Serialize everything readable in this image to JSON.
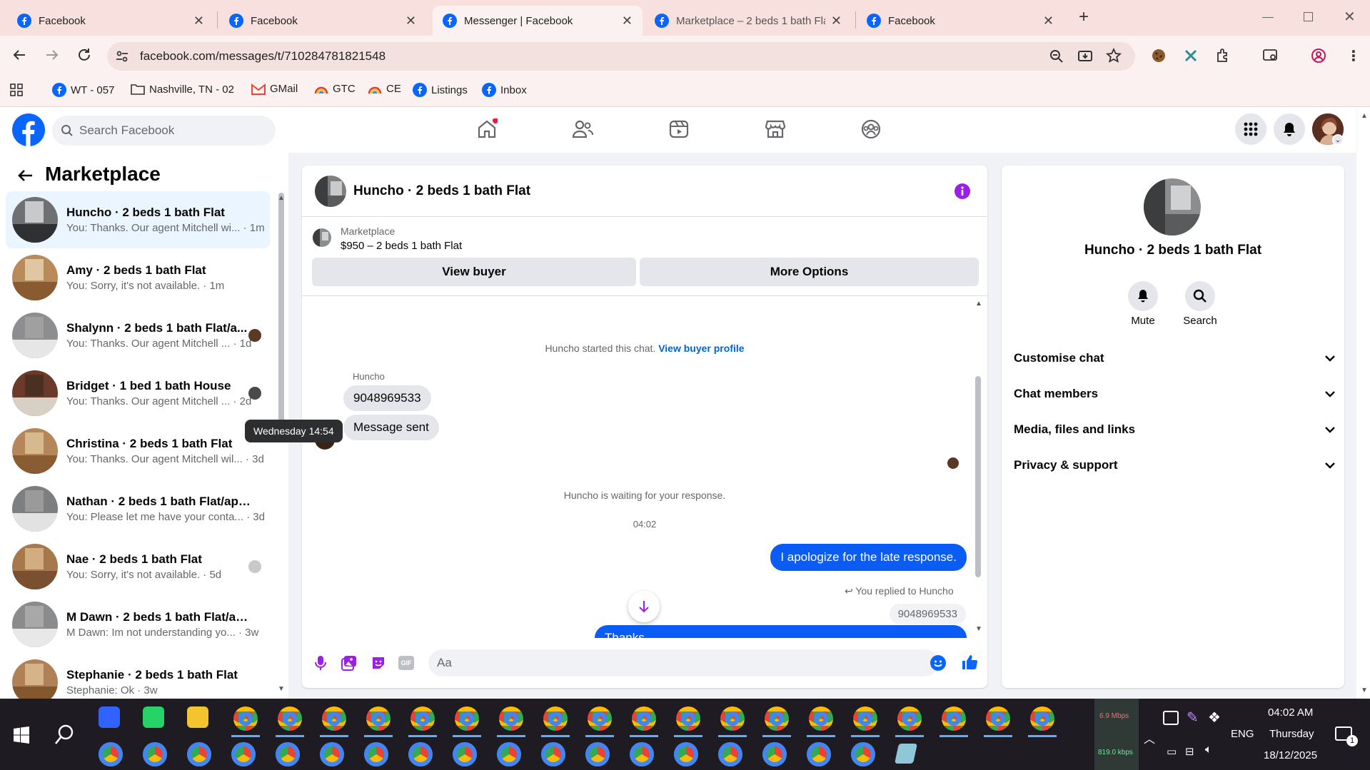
{
  "browser": {
    "tabs": [
      {
        "title": "Facebook",
        "active": false
      },
      {
        "title": "Facebook",
        "active": false
      },
      {
        "title": "Messenger | Facebook",
        "active": true
      },
      {
        "title": "Marketplace – 2 beds 1 bath Fla",
        "active": false
      },
      {
        "title": "Facebook",
        "active": false
      }
    ],
    "new_tab": "+",
    "url": "facebook.com/messages/t/710284781821548",
    "bookmarks": [
      "WT - 057",
      "Nashville, TN - 02",
      "GMail",
      "GTC",
      "CE",
      "Listings",
      "Inbox"
    ]
  },
  "fb": {
    "search_placeholder": "Search Facebook",
    "accent": "#0866ff"
  },
  "left": {
    "title": "Marketplace",
    "conversations": [
      {
        "name": "Huncho · 2 beds 1 bath Flat",
        "preview": "You: Thanks. Our agent Mitchell wi... · 1m",
        "active": true
      },
      {
        "name": "Amy · 2 beds 1 bath Flat",
        "preview": "You: Sorry, it's not available. · 1m",
        "active": false
      },
      {
        "name": "Shalynn · 2 beds 1 bath Flat/a...",
        "preview": "You: Thanks. Our agent Mitchell ... · 1d",
        "active": false
      },
      {
        "name": "Bridget · 1 bed 1 bath House",
        "preview": "You: Thanks. Our agent Mitchell ... · 2d",
        "active": false
      },
      {
        "name": "Christina · 2 beds 1 bath Flat",
        "preview": "You: Thanks. Our agent Mitchell wil... · 3d",
        "active": false
      },
      {
        "name": "Nathan · 2 beds 1 bath Flat/apar...",
        "preview": "You: Please let me have your conta... · 3d",
        "active": false
      },
      {
        "name": "Nae · 2 beds 1 bath Flat",
        "preview": "You: Sorry, it's not available. · 5d",
        "active": false
      },
      {
        "name": "M Dawn · 2 beds 1 bath Flat/apa...",
        "preview": "M Dawn: Im not understanding yo... · 3w",
        "active": false
      },
      {
        "name": "Stephanie · 2 beds 1 bath Flat",
        "preview": "Stephanie: Ok · 3w",
        "active": false
      }
    ]
  },
  "chat": {
    "title": "Huncho · 2 beds 1 bath Flat",
    "listing_source": "Marketplace",
    "listing_title": "$950 – 2 beds 1 bath Flat",
    "view_buyer": "View buyer",
    "more_options": "More Options",
    "started_text": "Huncho started this chat.",
    "buyer_profile_link": "View buyer profile",
    "sender_name": "Huncho",
    "msg1": "9048969533",
    "msg2": "Message sent",
    "tooltip": "Wednesday 14:54",
    "waiting": "Huncho is waiting for your response.",
    "time": "04:02",
    "out1": "I apologize for the late response.",
    "replied_to": "You replied to Huncho",
    "quoted": "9048969533",
    "out2": "Thanks...",
    "composer_placeholder": "Aa"
  },
  "info": {
    "name": "Huncho · 2 beds 1 bath Flat",
    "mute": "Mute",
    "search": "Search",
    "sections": [
      "Customise chat",
      "Chat members",
      "Media, files and links",
      "Privacy & support"
    ]
  },
  "taskbar": {
    "net_up": "6.9 Mbps",
    "net_down": "819.0 kbps",
    "lang": "ENG",
    "time": "04:02 AM",
    "day": "Thursday",
    "date": "18/12/2025",
    "notif": "1"
  }
}
